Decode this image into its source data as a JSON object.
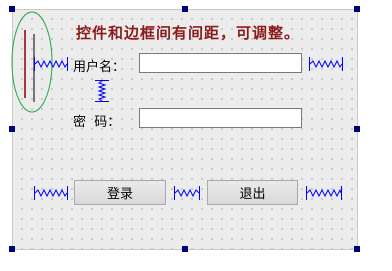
{
  "title_label": "控件和边框间有间距，可调整。",
  "username": {
    "label": "用户名：",
    "value": "",
    "placeholder": ""
  },
  "password": {
    "label": "密  码：",
    "value": "",
    "placeholder": ""
  },
  "buttons": {
    "login_label": "登录",
    "exit_label": "退出"
  },
  "colors": {
    "title_text": "#8b1a1a",
    "spacer_blue": "#0000ff",
    "selection_handle": "#00007a",
    "ellipse_green": "#22aa44",
    "ellipse_inner_line": "#8b0000",
    "grid_dot": "#9a9a9a"
  },
  "icons": {
    "spacer": "horizontal-spring-icon",
    "vertical_spacer": "vertical-spring-icon",
    "handle": "selection-handle-square"
  }
}
